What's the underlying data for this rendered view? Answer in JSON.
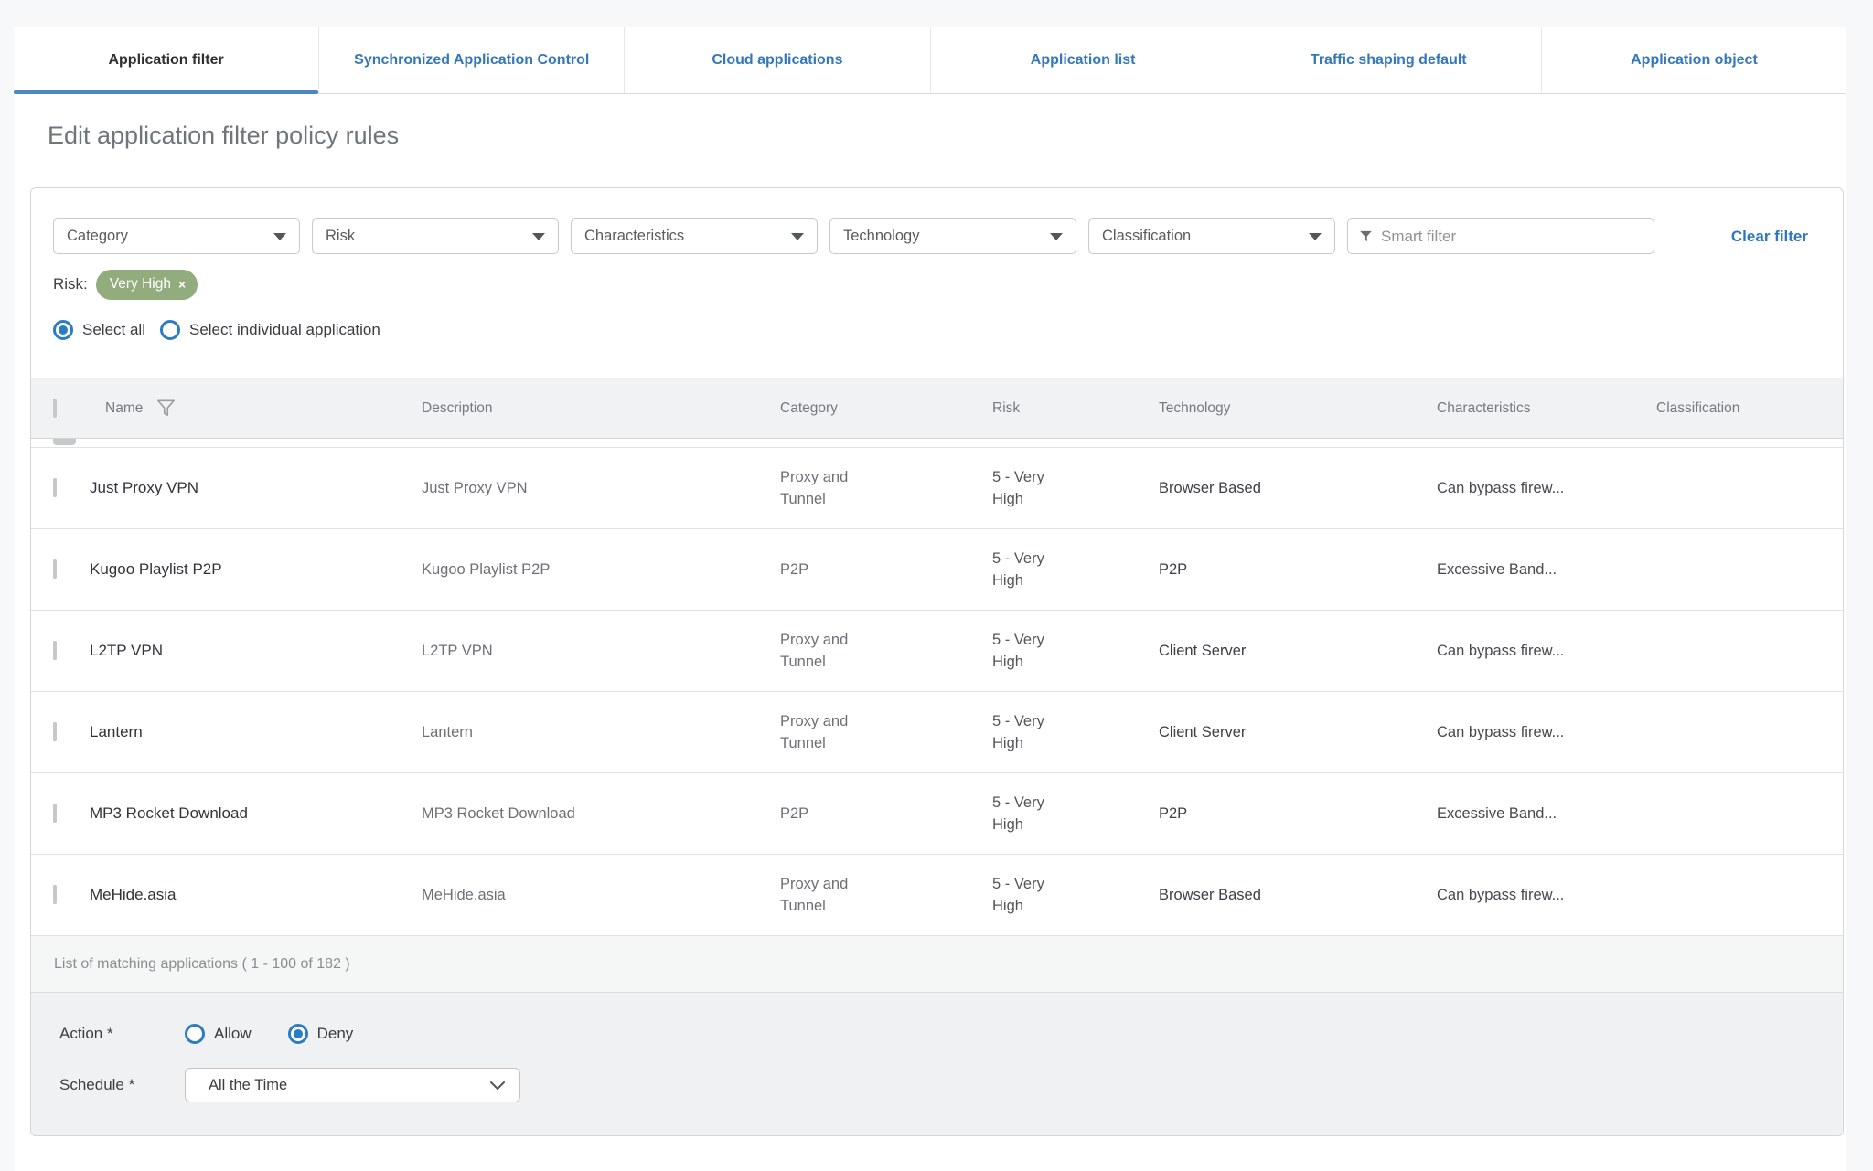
{
  "tabs": [
    {
      "label": "Application filter",
      "active": true
    },
    {
      "label": "Synchronized Application Control",
      "active": false
    },
    {
      "label": "Cloud applications",
      "active": false
    },
    {
      "label": "Application list",
      "active": false
    },
    {
      "label": "Traffic shaping default",
      "active": false
    },
    {
      "label": "Application object",
      "active": false
    }
  ],
  "page": {
    "title": "Edit application filter policy rules"
  },
  "filters": {
    "dropdowns": [
      "Category",
      "Risk",
      "Characteristics",
      "Technology",
      "Classification"
    ],
    "smart_placeholder": "Smart filter",
    "clear_label": "Clear filter"
  },
  "active_filter": {
    "label": "Risk:",
    "chip": "Very High",
    "remove": "×"
  },
  "selection": {
    "options": [
      {
        "label": "Select all",
        "selected": true
      },
      {
        "label": "Select individual application",
        "selected": false
      }
    ]
  },
  "table": {
    "columns": {
      "name": "Name",
      "description": "Description",
      "category": "Category",
      "risk": "Risk",
      "technology": "Technology",
      "characteristics": "Characteristics",
      "classification": "Classification"
    },
    "rows": [
      {
        "checked": true,
        "name": "Just Proxy VPN",
        "description": "Just Proxy VPN",
        "category": "Proxy and Tunnel",
        "risk": "5 - Very High",
        "technology": "Browser Based",
        "characteristics": "Can bypass firew...",
        "classification": ""
      },
      {
        "checked": true,
        "name": "Kugoo Playlist P2P",
        "description": "Kugoo Playlist P2P",
        "category": "P2P",
        "risk": "5 - Very High",
        "technology": "P2P",
        "characteristics": "Excessive Band...",
        "classification": ""
      },
      {
        "checked": true,
        "name": "L2TP VPN",
        "description": "L2TP VPN",
        "category": "Proxy and Tunnel",
        "risk": "5 - Very High",
        "technology": "Client Server",
        "characteristics": "Can bypass firew...",
        "classification": ""
      },
      {
        "checked": true,
        "name": "Lantern",
        "description": "Lantern",
        "category": "Proxy and Tunnel",
        "risk": "5 - Very High",
        "technology": "Client Server",
        "characteristics": "Can bypass firew...",
        "classification": ""
      },
      {
        "checked": true,
        "name": "MP3 Rocket Download",
        "description": "MP3 Rocket Download",
        "category": "P2P",
        "risk": "5 - Very High",
        "technology": "P2P",
        "characteristics": "Excessive Band...",
        "classification": ""
      },
      {
        "checked": true,
        "name": "MeHide.asia",
        "description": "MeHide.asia",
        "category": "Proxy and Tunnel",
        "risk": "5 - Very High",
        "technology": "Browser Based",
        "characteristics": "Can bypass firew...",
        "classification": ""
      }
    ],
    "footer": "List of matching applications ( 1 - 100 of 182 )"
  },
  "form": {
    "action": {
      "label": "Action *",
      "options": [
        {
          "label": "Allow",
          "selected": false
        },
        {
          "label": "Deny",
          "selected": true
        }
      ]
    },
    "schedule": {
      "label": "Schedule *",
      "value": "All the Time"
    }
  },
  "colors": {
    "accent_blue": "#2e77bc",
    "tab_underline": "#4d87c0",
    "radio_blue": "#2b7cc3",
    "chip_green": "#92ac7d",
    "header_bg": "#f1f2f3",
    "footer_bg": "#f5f6f6",
    "bottom_bg": "#f0f1f2"
  }
}
